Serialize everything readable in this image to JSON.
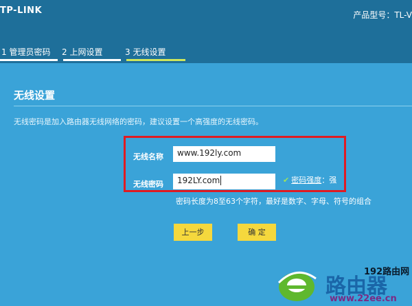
{
  "header": {
    "logo": "TP-LINK",
    "model_label": "产品型号：TL-V"
  },
  "steps": [
    {
      "label": "1 管理员密码",
      "active": false
    },
    {
      "label": "2 上网设置",
      "active": false
    },
    {
      "label": "3 无线设置",
      "active": true
    }
  ],
  "section": {
    "title": "无线设置",
    "description": "无线密码是加入路由器无线网络的密码，建议设置一个高强度的无线密码。"
  },
  "form": {
    "ssid_label": "无线名称",
    "ssid_value": "www.192ly.com",
    "password_label": "无线密码",
    "password_value": "192LY.com",
    "strength_link": "密码强度",
    "strength_sep": "：",
    "strength_value": "强",
    "hint": "密码长度为8至63个字符，最好是数字、字母、符号的组合"
  },
  "buttons": {
    "prev": "上一步",
    "confirm": "确 定"
  },
  "watermark": {
    "top": "192路由网",
    "brand": "路由器",
    "url": "www.22ee.cn"
  },
  "colors": {
    "header_bg": "#1e6f9a",
    "content_bg": "#3aa3d8",
    "button": "#f5d83d",
    "highlight_box": "#e01b22",
    "active_step": "#cfe65c"
  }
}
